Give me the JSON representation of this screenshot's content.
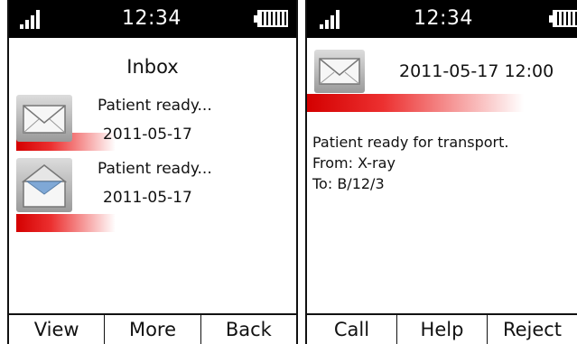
{
  "status": {
    "time": "12:34",
    "signal_icon": "signal-icon",
    "battery_icon": "battery-icon"
  },
  "inbox": {
    "title": "Inbox",
    "messages": [
      {
        "preview": "Patient ready...",
        "date": "2011-05-17",
        "icon": "envelope-closed-icon"
      },
      {
        "preview": "Patient ready...",
        "date": "2011-05-17",
        "icon": "envelope-open-icon"
      }
    ],
    "softkeys": [
      "View",
      "More",
      "Back"
    ]
  },
  "detail": {
    "datetime": "2011-05-17 12:00",
    "body": "Patient ready for transport.",
    "from": "From: X-ray",
    "to": "To: B/12/3",
    "softkeys": [
      "Call",
      "Help",
      "Reject"
    ]
  },
  "colors": {
    "accent_red": "#d40000",
    "statusbar": "#000000"
  }
}
